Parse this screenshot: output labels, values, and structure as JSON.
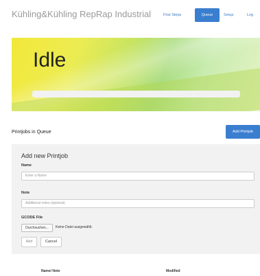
{
  "header": {
    "brand": "Kühling&Kühling RepRap Industrial",
    "nav": [
      {
        "label": "First Steps",
        "active": false
      },
      {
        "label": "Queue",
        "active": true
      },
      {
        "label": "Setup",
        "active": false
      },
      {
        "label": "Log",
        "active": false
      }
    ]
  },
  "status": {
    "state": "Idle",
    "progress": 0
  },
  "queue": {
    "title": "Printjobs in Queue",
    "add_button": "Add Printjob",
    "form": {
      "title": "Add new Printjob",
      "name_label": "Name",
      "name_placeholder": "Enter a Name",
      "note_label": "Note",
      "note_placeholder": "Additional notes (optional)",
      "file_label": "GCODE File",
      "file_button": "Durchsuchen...",
      "file_status": "Keine Datei ausgewählt.",
      "add_button": "Add",
      "cancel_button": "Cancel"
    },
    "table": {
      "columns": [
        "Name/ Note",
        "Modified"
      ]
    }
  },
  "colors": {
    "accent": "#3a7ed0",
    "panel_bg": "#f2f2f2"
  }
}
